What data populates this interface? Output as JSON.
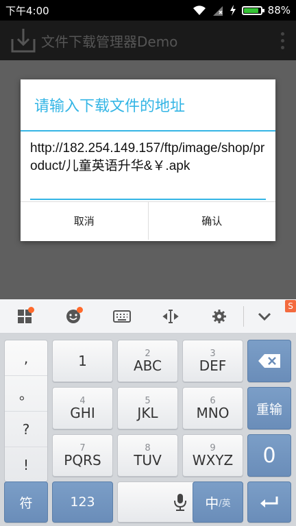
{
  "status_bar": {
    "time": "下午4:00",
    "battery": "88%",
    "battery_level": 0.88
  },
  "app": {
    "title": "文件下载管理器Demo"
  },
  "dialog": {
    "title": "请输入下载文件的地址",
    "url_value": "http://182.254.149.157/ftp/image/shop/product/儿童英语升华&￥.apk",
    "cancel_label": "取消",
    "confirm_label": "确认"
  },
  "keyboard": {
    "punctuation": [
      ",",
      "。",
      "?",
      "!"
    ],
    "keys": [
      {
        "num": "",
        "letters": "1"
      },
      {
        "num": "2",
        "letters": "ABC"
      },
      {
        "num": "3",
        "letters": "DEF"
      },
      {
        "num": "4",
        "letters": "GHI"
      },
      {
        "num": "5",
        "letters": "JKL"
      },
      {
        "num": "6",
        "letters": "MNO"
      },
      {
        "num": "7",
        "letters": "PQRS"
      },
      {
        "num": "8",
        "letters": "TUV"
      },
      {
        "num": "9",
        "letters": "WXYZ"
      }
    ],
    "reinput_label": "重输",
    "zero_label": "0",
    "symbol_label": "符",
    "num_mode_label": "123",
    "lang_main": "中",
    "lang_alt": "/英"
  }
}
